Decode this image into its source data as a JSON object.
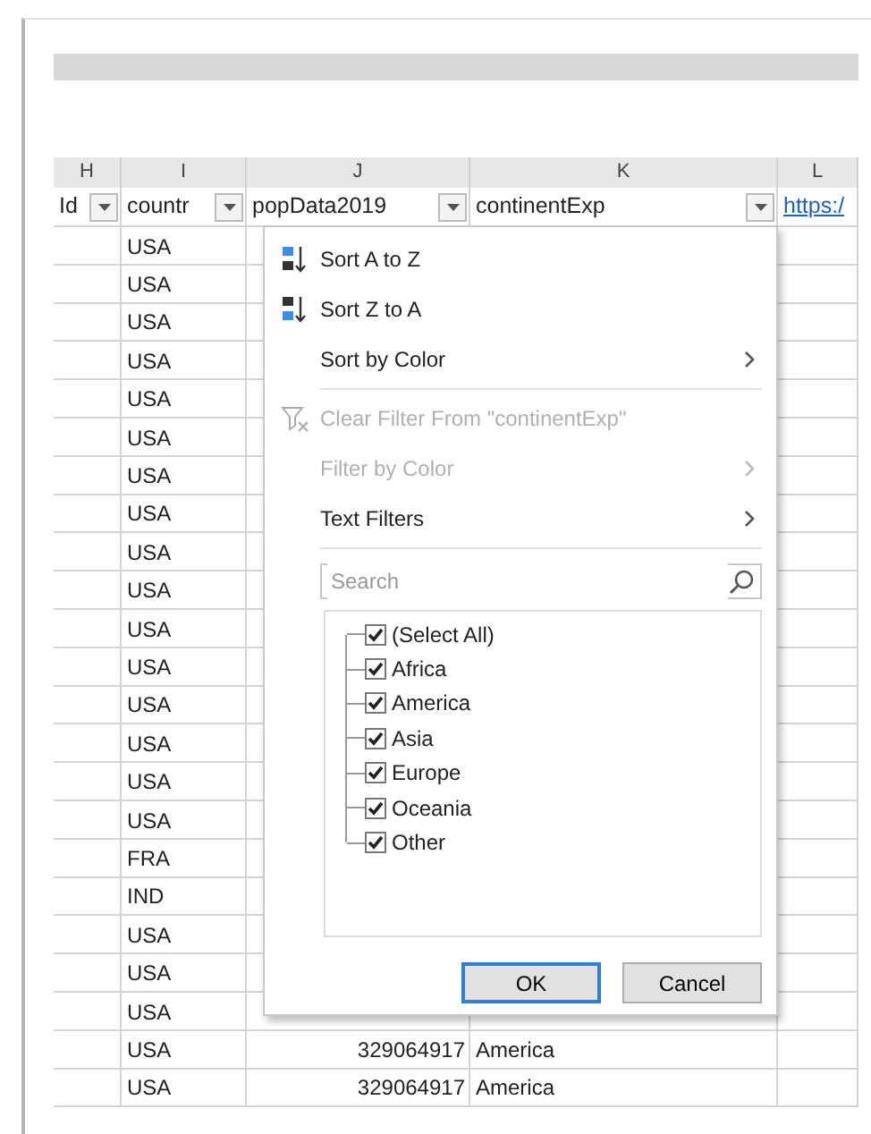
{
  "column_letters": [
    "H",
    "I",
    "J",
    "K",
    "L"
  ],
  "header_row": [
    {
      "text": "Id",
      "filter": true,
      "link": false
    },
    {
      "text": "countr",
      "filter": true,
      "link": false
    },
    {
      "text": "popData2019",
      "filter": true,
      "link": false
    },
    {
      "text": "continentExp",
      "filter": true,
      "link": false
    },
    {
      "text": "https:/",
      "filter": false,
      "link": true
    }
  ],
  "rows": [
    {
      "country": "USA"
    },
    {
      "country": "USA"
    },
    {
      "country": "USA"
    },
    {
      "country": "USA"
    },
    {
      "country": "USA"
    },
    {
      "country": "USA"
    },
    {
      "country": "USA"
    },
    {
      "country": "USA"
    },
    {
      "country": "USA"
    },
    {
      "country": "USA"
    },
    {
      "country": "USA"
    },
    {
      "country": "USA"
    },
    {
      "country": "USA"
    },
    {
      "country": "USA"
    },
    {
      "country": "USA"
    },
    {
      "country": "USA"
    },
    {
      "country": "FRA"
    },
    {
      "country": "IND"
    },
    {
      "country": "USA"
    },
    {
      "country": "USA"
    },
    {
      "country": "USA"
    },
    {
      "country": "USA",
      "popData2019": "329064917",
      "continentExp": "America"
    },
    {
      "country": "USA",
      "popData2019": "329064917",
      "continentExp": "America"
    }
  ],
  "filter_menu": {
    "items": [
      {
        "kind": "sort_az",
        "label": "Sort A to Z",
        "disabled": false,
        "submenu": false
      },
      {
        "kind": "sort_za",
        "label": "Sort Z to A",
        "disabled": false,
        "submenu": false
      },
      {
        "kind": "plain",
        "label": "Sort by Color",
        "disabled": false,
        "submenu": true
      },
      {
        "kind": "separator"
      },
      {
        "kind": "clear_filter",
        "label": "Clear Filter From \"continentExp\"",
        "disabled": true,
        "submenu": false
      },
      {
        "kind": "plain",
        "label": "Filter by Color",
        "disabled": true,
        "submenu": true
      },
      {
        "kind": "plain",
        "label": "Text Filters",
        "disabled": false,
        "submenu": true
      },
      {
        "kind": "separator"
      }
    ],
    "search": {
      "placeholder": "Search"
    },
    "values": [
      {
        "label": "(Select All)",
        "checked": true
      },
      {
        "label": "Africa",
        "checked": true
      },
      {
        "label": "America",
        "checked": true
      },
      {
        "label": "Asia",
        "checked": true
      },
      {
        "label": "Europe",
        "checked": true
      },
      {
        "label": "Oceania",
        "checked": true
      },
      {
        "label": "Other",
        "checked": true
      }
    ],
    "buttons": [
      {
        "label": "OK",
        "focused": true
      },
      {
        "label": "Cancel",
        "focused": false
      }
    ]
  }
}
